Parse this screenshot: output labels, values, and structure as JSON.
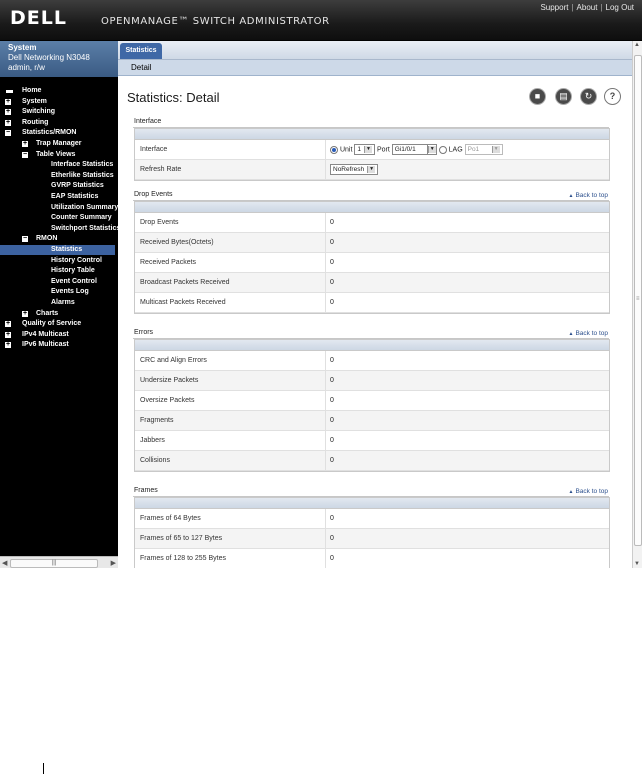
{
  "header": {
    "logo": "D&#8203;ELL",
    "logo_text": "DELL",
    "product": "OPENMANAGE™ SWITCH ADMINISTRATOR",
    "links": [
      "Support",
      "About",
      "Log Out"
    ]
  },
  "system": {
    "title": "System",
    "model": "Dell Networking N3048",
    "user": "admin, r/w"
  },
  "nav": [
    {
      "label": "Home",
      "level": 0,
      "marker": "home"
    },
    {
      "label": "System",
      "level": 0,
      "marker": "+"
    },
    {
      "label": "Switching",
      "level": 0,
      "marker": "+"
    },
    {
      "label": "Routing",
      "level": 0,
      "marker": "+"
    },
    {
      "label": "Statistics/RMON",
      "level": 0,
      "marker": "-"
    },
    {
      "label": "Trap Manager",
      "level": 1,
      "marker": "+"
    },
    {
      "label": "Table Views",
      "level": 1,
      "marker": "-"
    },
    {
      "label": "Interface Statistics",
      "level": 2
    },
    {
      "label": "Etherlike Statistics",
      "level": 2
    },
    {
      "label": "GVRP Statistics",
      "level": 2
    },
    {
      "label": "EAP Statistics",
      "level": 2
    },
    {
      "label": "Utilization Summary",
      "level": 2
    },
    {
      "label": "Counter Summary",
      "level": 2
    },
    {
      "label": "Switchport Statistics",
      "level": 2
    },
    {
      "label": "RMON",
      "level": 1,
      "marker": "-"
    },
    {
      "label": "Statistics",
      "level": 2,
      "selected": true
    },
    {
      "label": "History Control",
      "level": 2
    },
    {
      "label": "History Table",
      "level": 2
    },
    {
      "label": "Event Control",
      "level": 2
    },
    {
      "label": "Events Log",
      "level": 2
    },
    {
      "label": "Alarms",
      "level": 2
    },
    {
      "label": "Charts",
      "level": 1,
      "marker": "+"
    },
    {
      "label": "Quality of Service",
      "level": 0,
      "marker": "+"
    },
    {
      "label": "IPv4 Multicast",
      "level": 0,
      "marker": "+"
    },
    {
      "label": "IPv6 Multicast",
      "level": 0,
      "marker": "+"
    }
  ],
  "tabs": {
    "main": "Statistics",
    "sub": "Detail"
  },
  "page_title": "Statistics: Detail",
  "back_to_top": "Back to top",
  "interface": {
    "section": "Interface",
    "interface_label": "Interface",
    "unit_label": "Unit",
    "unit_value": "1",
    "port_label": "Port",
    "port_value": "Gi1/0/1",
    "lag_label": "LAG",
    "lag_value": "Po1",
    "refresh_label": "Refresh Rate",
    "refresh_value": "NoRefresh"
  },
  "sections": [
    {
      "title": "Drop Events",
      "rows": [
        {
          "label": "Drop Events",
          "value": "0"
        },
        {
          "label": "Received Bytes(Octets)",
          "value": "0"
        },
        {
          "label": "Received Packets",
          "value": "0"
        },
        {
          "label": "Broadcast Packets Received",
          "value": "0"
        },
        {
          "label": "Multicast Packets Received",
          "value": "0"
        }
      ]
    },
    {
      "title": "Errors",
      "rows": [
        {
          "label": "CRC and Align Errors",
          "value": "0"
        },
        {
          "label": "Undersize Packets",
          "value": "0"
        },
        {
          "label": "Oversize Packets",
          "value": "0"
        },
        {
          "label": "Fragments",
          "value": "0"
        },
        {
          "label": "Jabbers",
          "value": "0"
        },
        {
          "label": "Collisions",
          "value": "0"
        }
      ]
    },
    {
      "title": "Frames",
      "rows": [
        {
          "label": "Frames of 64 Bytes",
          "value": "0"
        },
        {
          "label": "Frames of 65 to 127 Bytes",
          "value": "0"
        },
        {
          "label": "Frames of 128 to 255 Bytes",
          "value": "0"
        }
      ]
    }
  ],
  "icons": {
    "save": "save-icon",
    "print": "print-icon",
    "refresh": "refresh-icon",
    "help": "help-icon"
  },
  "colors": {
    "header_bg": "#1a1a1a",
    "sidebar_bg": "#000000",
    "selected": "#3c62a0",
    "tab_active": "#3f68a6"
  }
}
